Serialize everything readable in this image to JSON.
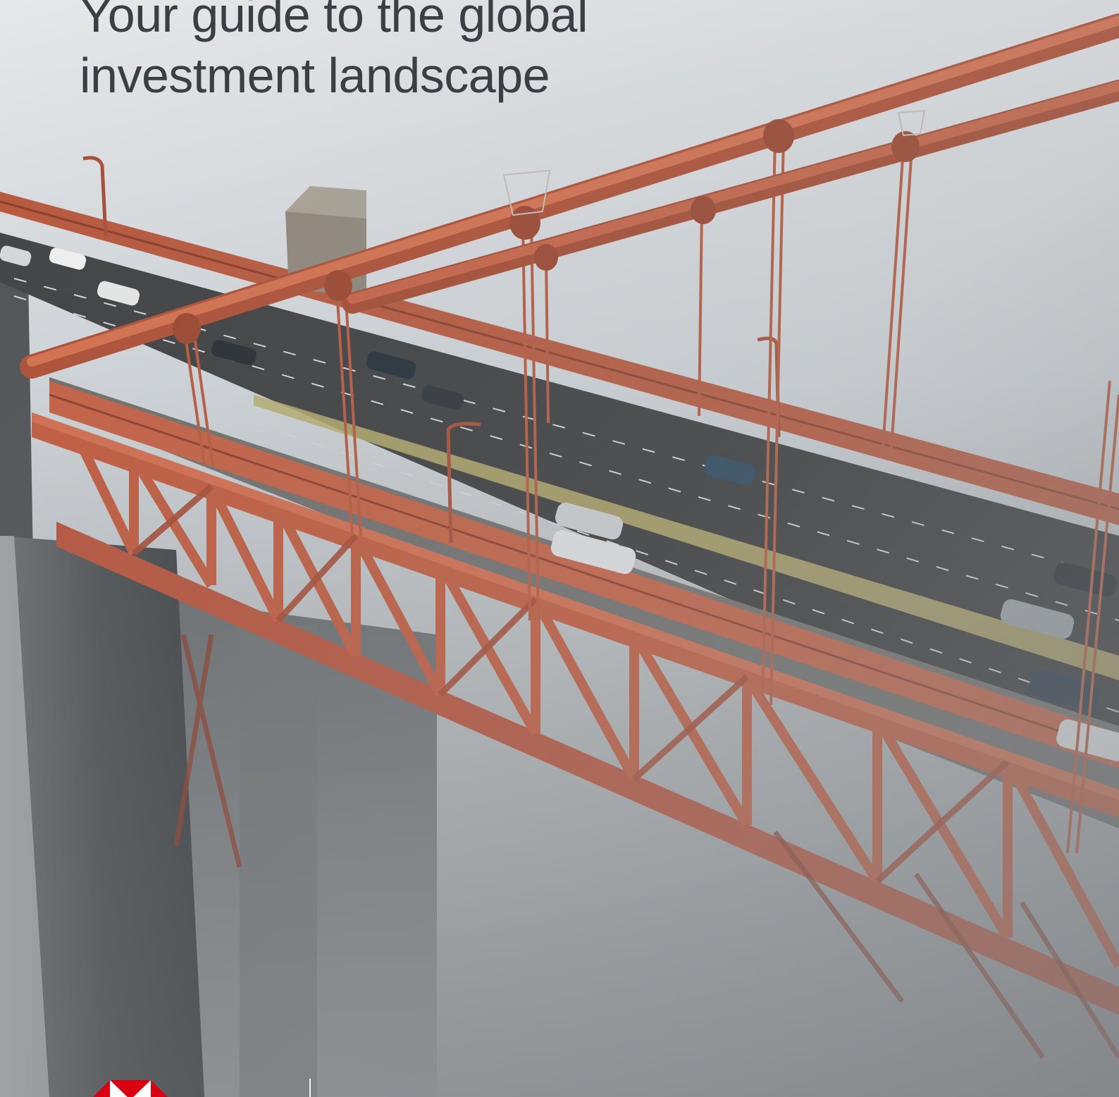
{
  "cover": {
    "headline_line_1": "Your guide to the global",
    "headline_line_2": "investment landscape",
    "photo_subject": "aerial-view-suspension-bridge-in-fog",
    "brand_logo_icon": "hexagon-logo-icon"
  },
  "colors": {
    "sky": "#dfe3e6",
    "fog": "#9ea2a5",
    "bridge_red": "#c0573a",
    "bridge_red_shade": "#8d3a26",
    "road": "#3a3b3c",
    "tower_concrete": "#5b5f60",
    "headline_text": "#3b3f44",
    "brand_red": "#db0011"
  }
}
